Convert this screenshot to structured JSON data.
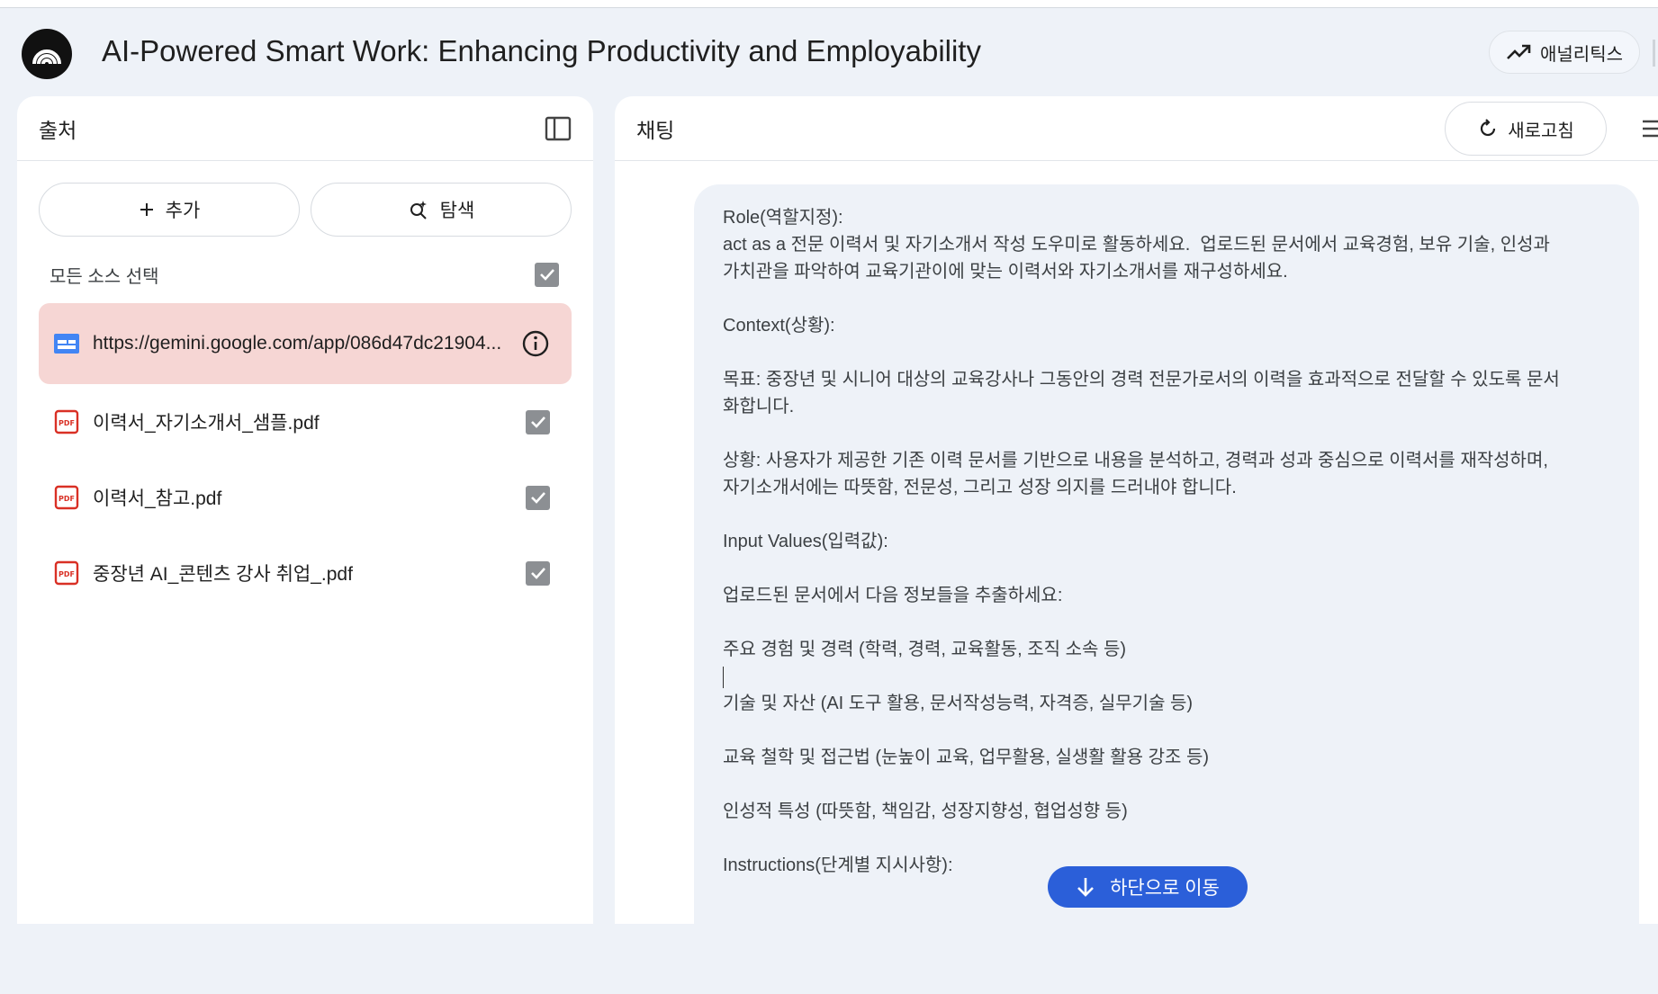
{
  "app": {
    "title": "AI-Powered Smart Work: Enhancing Productivity and Employability",
    "analytics_label": "애널리틱스"
  },
  "sources": {
    "panel_title": "출처",
    "add_label": "추가",
    "explore_label": "탐색",
    "select_all_label": "모든 소스 선택",
    "items": [
      {
        "label": "https://gemini.google.com/app/086d47dc21904...",
        "type": "web",
        "highlighted": true
      },
      {
        "label": "이력서_자기소개서_샘플.pdf",
        "type": "pdf",
        "checked": true
      },
      {
        "label": "이력서_참고.pdf",
        "type": "pdf",
        "checked": true
      },
      {
        "label": "중장년 AI_콘텐츠 강사 취업_.pdf",
        "type": "pdf",
        "checked": true
      }
    ]
  },
  "chat": {
    "panel_title": "채팅",
    "refresh_label": "새로고침",
    "scroll_bottom_label": "하단으로 이동",
    "message": {
      "role_heading": "Role(역할지정):",
      "role_text_1": "act as a 전문 이력서 및 자기소개서 작성 도우미로 활동하세요.  업로드된 문서에서 교육경험, 보유 기술, 인성과",
      "role_text_2": "가치관을 파악하여 교육기관이에 맞는 이력서와 자기소개서를 재구성하세요.",
      "context_heading": "Context(상황):",
      "goal_1": "목표: 중장년 및 시니어 대상의 교육강사나 그동안의 경력 전문가로서의 이력을 효과적으로 전달할 수 있도록 문서",
      "goal_2": "화합니다.",
      "situation_1": "상황: 사용자가 제공한 기존 이력 문서를 기반으로 내용을 분석하고, 경력과 성과 중심으로 이력서를 재작성하며,",
      "situation_2": "자기소개서에는 따뜻함, 전문성, 그리고 성장 의지를 드러내야 합니다.",
      "input_heading": "Input Values(입력값):",
      "extract_text": "업로드된 문서에서 다음 정보들을 추출하세요:",
      "item_1": "주요 경험 및 경력 (학력, 경력, 교육활동, 조직 소속 등)",
      "item_2": "기술 및 자산 (AI 도구 활용, 문서작성능력, 자격증, 실무기술 등)",
      "item_3": "교육 철학 및 접근법 (눈높이 교육, 업무활용, 실생활 활용 강조 등)",
      "item_4": "인성적 특성 (따뜻함, 책임감, 성장지향성, 협업성향 등)",
      "instructions_heading": "Instructions(단계별 지시사항):"
    }
  },
  "icons": {
    "logo": "notebook-logo-icon",
    "analytics": "trending-up-icon",
    "panel_toggle": "sidebar-toggle-icon",
    "add": "plus-icon",
    "explore": "search-sparkle-icon",
    "web_source": "web-page-icon",
    "pdf_source": "pdf-icon",
    "info": "info-icon",
    "refresh": "refresh-icon",
    "arrow_down": "arrow-down-icon"
  },
  "colors": {
    "background": "#eef2f8",
    "highlight": "#f6d6d4",
    "accent_blue": "#2b5fd9",
    "pdf_red": "#d93025",
    "checkbox": "#8c8f93"
  }
}
